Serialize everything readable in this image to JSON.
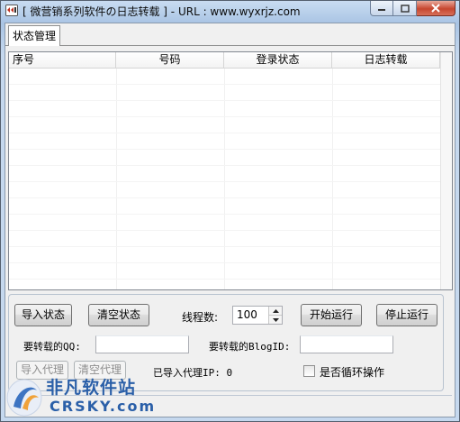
{
  "window": {
    "title": "[ 微营销系列软件の日志转载 ] - URL : www.wyxrjz.com",
    "icon": "app-icon",
    "controls": [
      "minimize-icon",
      "maximize-icon",
      "close-icon"
    ]
  },
  "tabs": [
    {
      "label": "状态管理"
    }
  ],
  "table": {
    "columns": [
      "序号",
      "号码",
      "登录状态",
      "日志转载"
    ],
    "rows": []
  },
  "controls": {
    "import_status": "导入状态",
    "clear_status": "清空状态",
    "threads_label": "线程数:",
    "threads_value": "100",
    "start": "开始运行",
    "stop": "停止运行",
    "qq_label": "要转载的QQ:",
    "qq_value": "",
    "blogid_label": "要转载的BlogID:",
    "blogid_value": "",
    "import_proxy": "导入代理",
    "clear_proxy": "清空代理",
    "imported_proxy_label": "已导入代理IP: 0",
    "loop_label": "是否循环操作",
    "loop_checked": false
  },
  "watermark": {
    "text_cn": "非凡软件站",
    "text_en": "CRSKY.com"
  },
  "colors": {
    "title_gradient": "#a9c4e4",
    "close_button": "#c7462f",
    "watermark": "#2a5fa8"
  }
}
